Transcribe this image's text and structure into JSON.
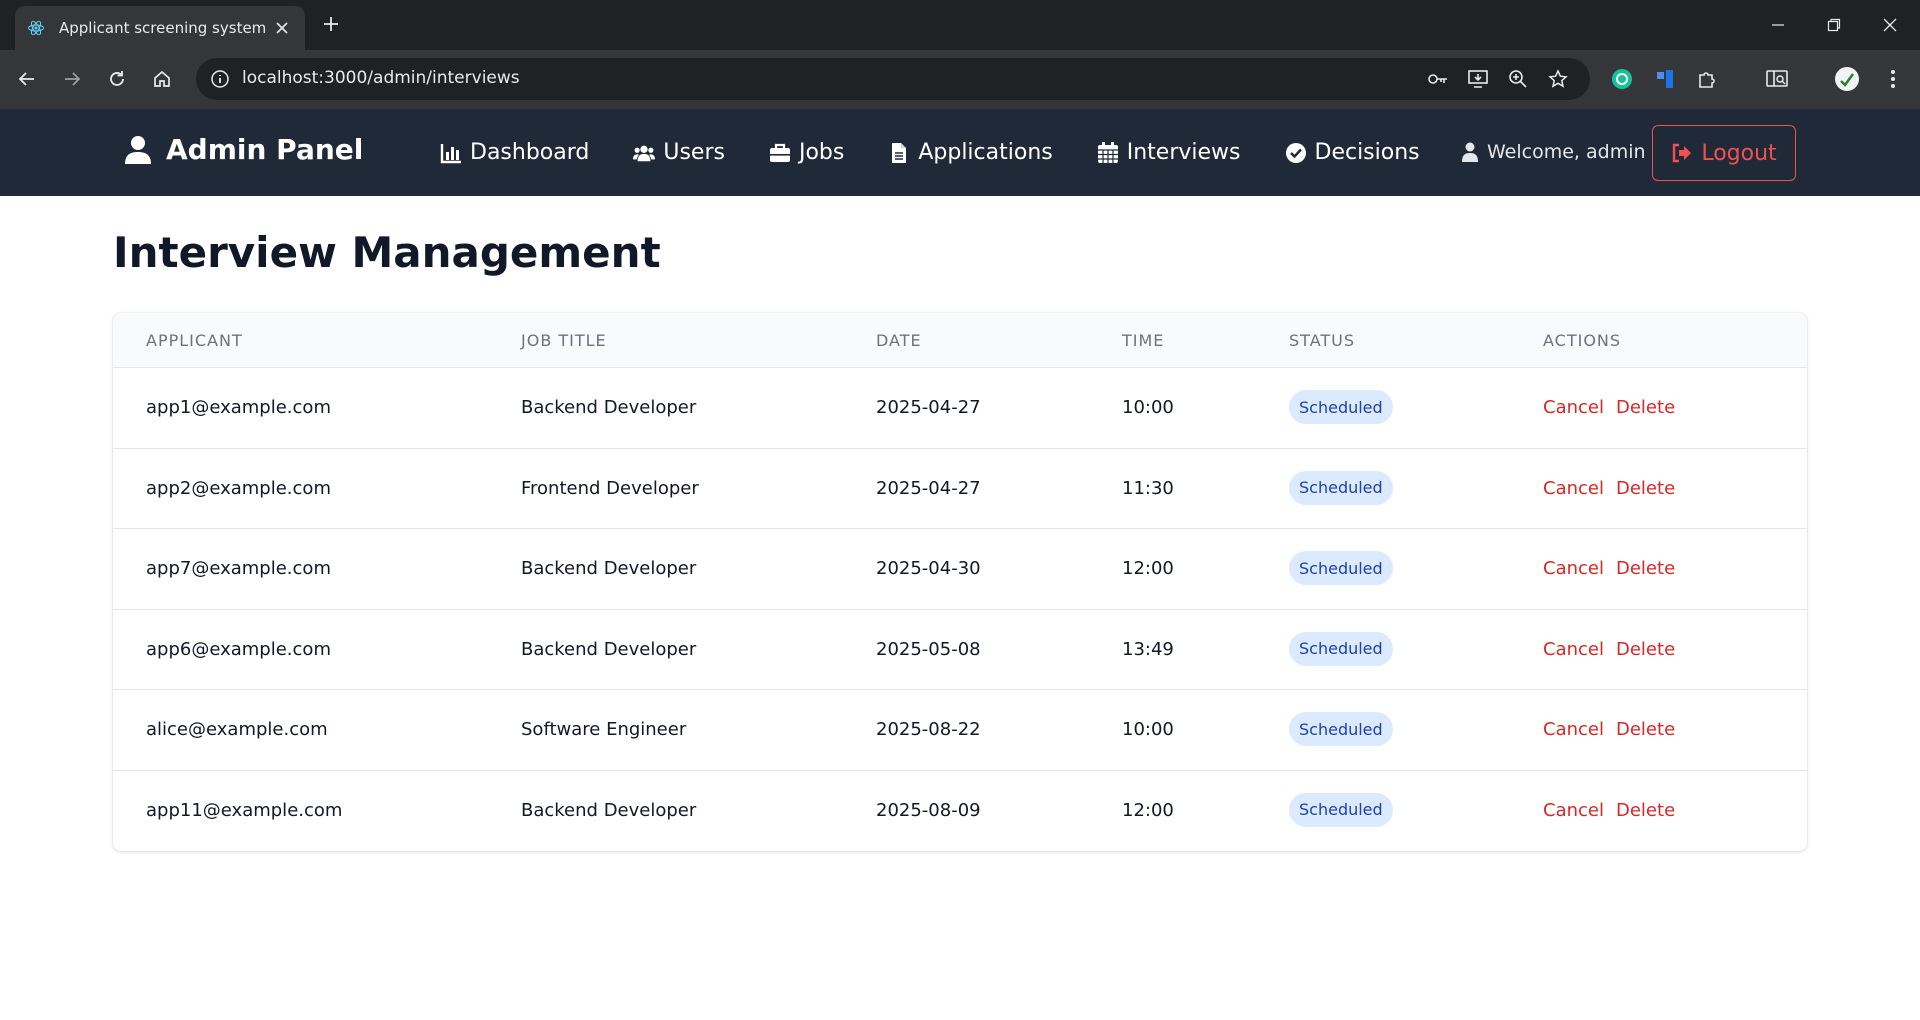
{
  "browser": {
    "tab_title": "Applicant screening system",
    "url": "localhost:3000/admin/interviews"
  },
  "navbar": {
    "brand": "Admin Panel",
    "links": [
      {
        "label": "Dashboard",
        "icon": "chart-icon"
      },
      {
        "label": "Users",
        "icon": "users-icon"
      },
      {
        "label": "Jobs",
        "icon": "briefcase-icon"
      },
      {
        "label": "Applications",
        "icon": "file-icon"
      },
      {
        "label": "Interviews",
        "icon": "calendar-icon"
      },
      {
        "label": "Decisions",
        "icon": "check-circle-icon"
      }
    ],
    "welcome": "Welcome, admin",
    "logout": "Logout"
  },
  "page": {
    "title": "Interview Management"
  },
  "table": {
    "headers": [
      "APPLICANT",
      "JOB TITLE",
      "DATE",
      "TIME",
      "STATUS",
      "ACTIONS"
    ],
    "rows": [
      {
        "applicant": "app1@example.com",
        "job": "Backend Developer",
        "date": "2025-04-27",
        "time": "10:00",
        "status": "Scheduled",
        "cancel": "Cancel",
        "delete": "Delete"
      },
      {
        "applicant": "app2@example.com",
        "job": "Frontend Developer",
        "date": "2025-04-27",
        "time": "11:30",
        "status": "Scheduled",
        "cancel": "Cancel",
        "delete": "Delete"
      },
      {
        "applicant": "app7@example.com",
        "job": "Backend Developer",
        "date": "2025-04-30",
        "time": "12:00",
        "status": "Scheduled",
        "cancel": "Cancel",
        "delete": "Delete"
      },
      {
        "applicant": "app6@example.com",
        "job": "Backend Developer",
        "date": "2025-05-08",
        "time": "13:49",
        "status": "Scheduled",
        "cancel": "Cancel",
        "delete": "Delete"
      },
      {
        "applicant": "alice@example.com",
        "job": "Software Engineer",
        "date": "2025-08-22",
        "time": "10:00",
        "status": "Scheduled",
        "cancel": "Cancel",
        "delete": "Delete"
      },
      {
        "applicant": "app11@example.com",
        "job": "Backend Developer",
        "date": "2025-08-09",
        "time": "12:00",
        "status": "Scheduled",
        "cancel": "Cancel",
        "delete": "Delete"
      }
    ]
  },
  "colors": {
    "navbar_bg": "#1f2937",
    "logout_accent": "#f05252",
    "action_red": "#dc2626",
    "badge_bg": "#dbeafe",
    "badge_text": "#1e40af"
  }
}
